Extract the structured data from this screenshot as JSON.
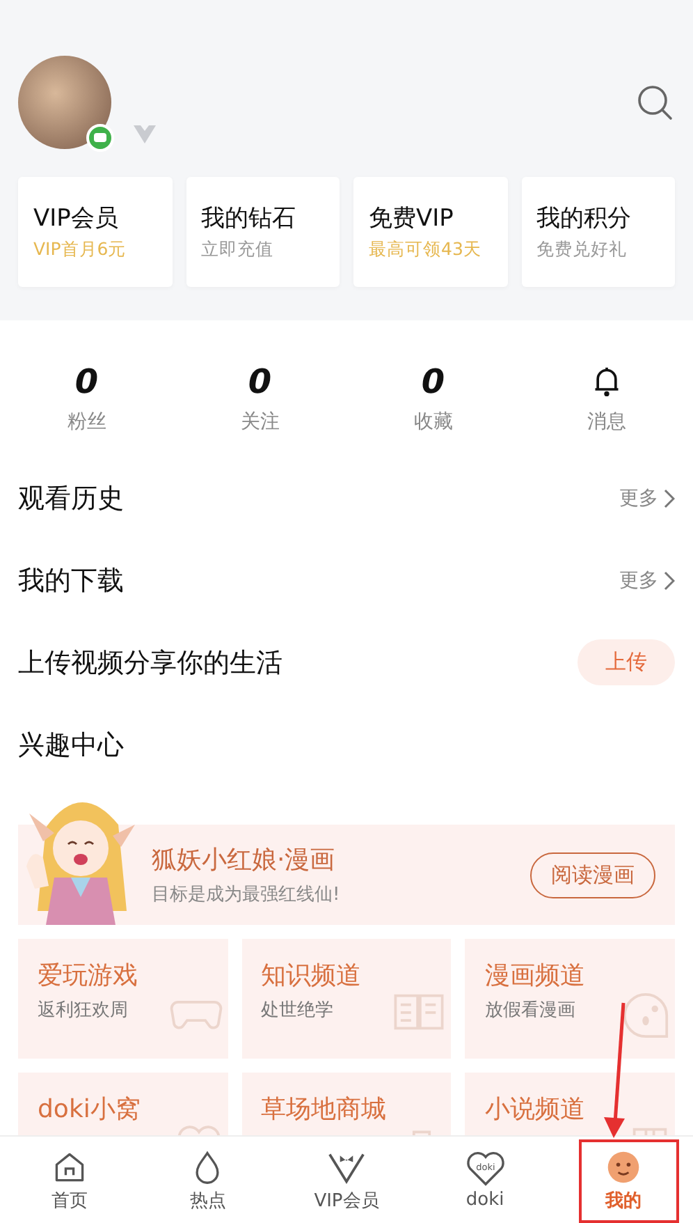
{
  "header": {
    "cards": [
      {
        "title": "VIP会员",
        "subtitle": "VIP首月6元",
        "highlight": true
      },
      {
        "title": "我的钻石",
        "subtitle": "立即充值",
        "highlight": false
      },
      {
        "title": "免费VIP",
        "subtitle": "最高可领43天",
        "highlight": true
      },
      {
        "title": "我的积分",
        "subtitle": "免费兑好礼",
        "highlight": false
      }
    ]
  },
  "stats": [
    {
      "kind": "count",
      "value": "0",
      "label": "粉丝"
    },
    {
      "kind": "count",
      "value": "0",
      "label": "关注"
    },
    {
      "kind": "count",
      "value": "0",
      "label": "收藏"
    },
    {
      "kind": "bell",
      "label": "消息"
    }
  ],
  "rows": [
    {
      "title": "观看历史",
      "kind": "more",
      "action": "更多"
    },
    {
      "title": "我的下载",
      "kind": "more",
      "action": "更多"
    },
    {
      "title": "上传视频分享你的生活",
      "kind": "button",
      "action": "上传"
    }
  ],
  "interest": {
    "title": "兴趣中心",
    "banner": {
      "title": "狐妖小红娘·漫画",
      "subtitle": "目标是成为最强红线仙!",
      "button": "阅读漫画"
    },
    "channels": [
      {
        "title": "爱玩游戏",
        "subtitle": "返利狂欢周",
        "kind": "gamepad"
      },
      {
        "title": "知识频道",
        "subtitle": "处世绝学",
        "kind": "book"
      },
      {
        "title": "漫画频道",
        "subtitle": "放假看漫画",
        "kind": "ghost"
      },
      {
        "title": "doki小窝",
        "kind": "heart"
      },
      {
        "title": "草场地商城",
        "kind": "bag"
      },
      {
        "title": "小说频道",
        "kind": "bookmark"
      }
    ]
  },
  "tabs": [
    {
      "label": "首页",
      "kind": "home",
      "selected": false
    },
    {
      "label": "热点",
      "kind": "flame",
      "selected": false
    },
    {
      "label": "VIP会员",
      "kind": "vip",
      "selected": false
    },
    {
      "label": "doki",
      "kind": "doki",
      "logo_text": "doki",
      "selected": false
    },
    {
      "label": "我的",
      "kind": "face",
      "selected": true
    }
  ]
}
